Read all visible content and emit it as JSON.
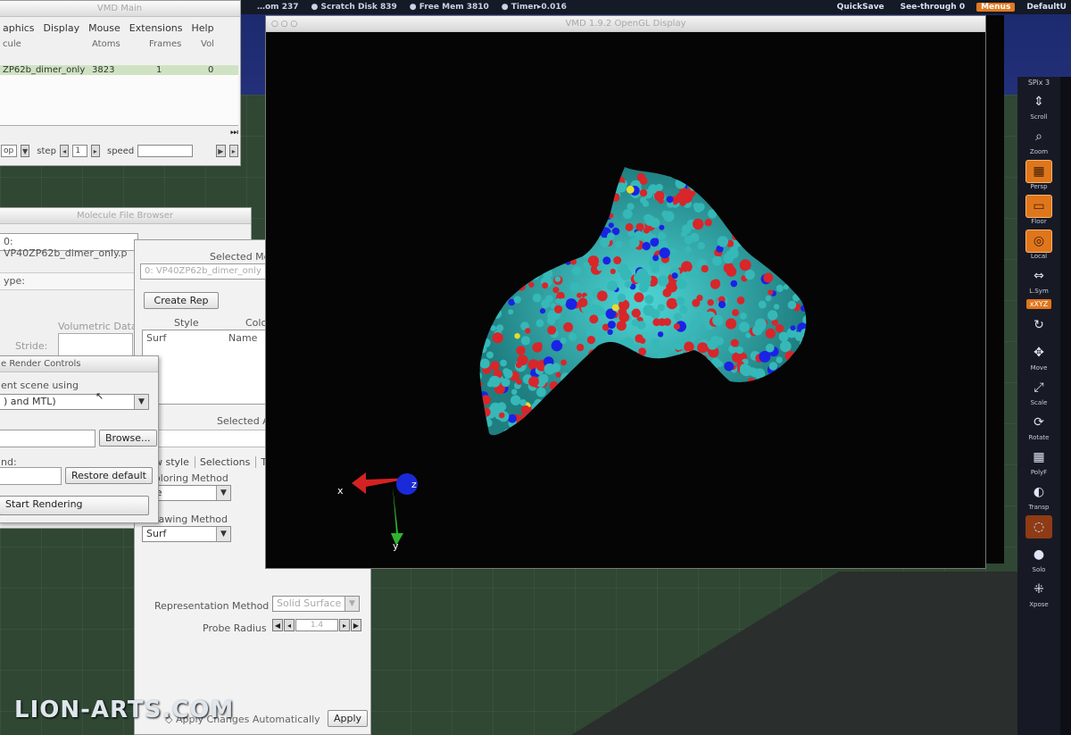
{
  "top_bar": {
    "stats": [
      "…om 237",
      "● Scratch Disk 839",
      "● Free Mem 3810",
      "● Timer▸0.016"
    ],
    "quicksave": "QuickSave",
    "see_through": "See-through  0",
    "menus_btn": "Menus",
    "default_btn": "DefaultU"
  },
  "right_shelf": {
    "spix": "SPix 3",
    "items": [
      {
        "label": "Scroll",
        "icon": "scroll-icon",
        "glyph": "⇕"
      },
      {
        "label": "Zoom",
        "icon": "zoom-icon",
        "glyph": "⌕"
      },
      {
        "label": "Persp",
        "icon": "perspective-icon",
        "glyph": "▦",
        "style": "orange"
      },
      {
        "label": "Floor",
        "icon": "floor-icon",
        "glyph": "▭",
        "style": "orange"
      },
      {
        "label": "Local",
        "icon": "local-icon",
        "glyph": "◎",
        "style": "orange"
      },
      {
        "label": "L.Sym",
        "icon": "lsym-icon",
        "glyph": "⇔"
      },
      {
        "label": "xyz",
        "icon": "xyz-icon",
        "glyph": "",
        "tag": "xXYZ"
      },
      {
        "label": "",
        "icon": "rotate-axis-icon",
        "glyph": "↻"
      },
      {
        "label": "Move",
        "icon": "move-icon",
        "glyph": "✥"
      },
      {
        "label": "Scale",
        "icon": "scale-icon",
        "glyph": "⤢"
      },
      {
        "label": "Rotate",
        "icon": "rotate-icon",
        "glyph": "⟳"
      },
      {
        "label": "PolyF",
        "icon": "polyframe-icon",
        "glyph": "▦"
      },
      {
        "label": "Transp",
        "icon": "transparency-icon",
        "glyph": "◐"
      },
      {
        "label": "",
        "icon": "ghost-icon",
        "glyph": "◌",
        "style": "dark-orange"
      },
      {
        "label": "Solo",
        "icon": "solo-icon",
        "glyph": "●"
      },
      {
        "label": "Xpose",
        "icon": "xpose-icon",
        "glyph": "⁜"
      }
    ]
  },
  "vmd_main": {
    "title": "VMD Main",
    "menus": [
      "aphics",
      "Display",
      "Mouse",
      "Extensions",
      "Help"
    ],
    "columns": [
      "cule",
      "Atoms",
      "Frames",
      "Vol"
    ],
    "molecule_row": {
      "name": "ZP62b_dimer_only",
      "atoms": "3823",
      "frames": "1",
      "vol": "0"
    },
    "anim": {
      "mode": "op",
      "step_label": "step",
      "step_value": "1",
      "speed_label": "speed"
    }
  },
  "file_browser": {
    "title": "Molecule File Browser",
    "molecule_field": "0: VP40ZP62b_dimer_only.p",
    "type_label": "ype:",
    "volumetric_label": "Volumetric Data",
    "stride_label": "Stride:"
  },
  "render_controls": {
    "title": "e Render Controls",
    "render_label": "ent scene using",
    "renderer_value": ") and MTL)",
    "browse_label": "Browse...",
    "command_label": "nd:",
    "restore_label": "Restore default",
    "start_label": "Start Rendering"
  },
  "graph_reps": {
    "selected_molecule_label": "Selected Mo",
    "molecule_value": "0: VP40ZP62b_dimer_only",
    "create_rep": "Create Rep",
    "col_style": "Style",
    "col_color": "Colo",
    "rep_style": "Surf",
    "rep_color": "Name",
    "selected_atoms_label": "Selected A",
    "tabs": [
      "w style",
      "Selections",
      "Tr"
    ],
    "coloring_label": "oloring Method",
    "coloring_value": "me",
    "drawing_label": "rawing Method",
    "drawing_value": "Surf",
    "rep_method_label": "Representation Method",
    "rep_method_value": "Solid Surface",
    "probe_label": "Probe Radius",
    "probe_value": "1.4",
    "apply_auto": "Apply Changes Automatically",
    "apply": "Apply"
  },
  "gl_display": {
    "title": "VMD 1.9.2 OpenGL Display",
    "axis_x": "x",
    "axis_y": "y",
    "axis_z": "z",
    "atom_colors": {
      "carbon": "#36b8b8",
      "oxygen": "#d8262a",
      "nitrogen": "#1a22e6",
      "sulfur": "#e6dd2a"
    }
  },
  "watermark": "LION-ARTS.COM"
}
